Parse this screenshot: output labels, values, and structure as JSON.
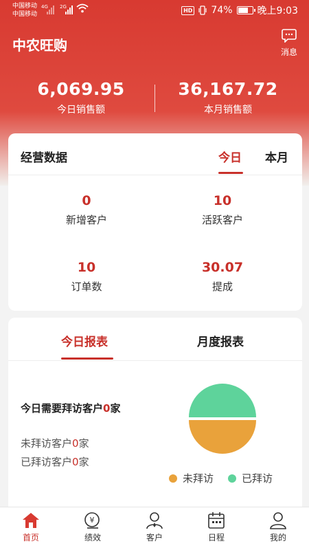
{
  "status_bar": {
    "carrier_1": "中国移动",
    "carrier_2": "中国移动",
    "net_1": "4G",
    "net_2": "2G",
    "hd": "HD",
    "battery": "74%",
    "battery_level": 0.74,
    "time": "晚上9:03"
  },
  "header": {
    "title": "中农旺购",
    "message_label": "消息",
    "message_icon": "chat-bubble-icon"
  },
  "totals": {
    "today": {
      "value": "6,069.95",
      "label": "今日销售额"
    },
    "month": {
      "value": "36,167.72",
      "label": "本月销售额"
    }
  },
  "business": {
    "title": "经营数据",
    "tabs": [
      {
        "label": "今日",
        "active": true
      },
      {
        "label": "本月",
        "active": false
      }
    ],
    "metrics": [
      {
        "value": "0",
        "label": "新增客户"
      },
      {
        "value": "10",
        "label": "活跃客户"
      },
      {
        "value": "10",
        "label": "订单数"
      },
      {
        "value": "30.07",
        "label": "提成"
      }
    ]
  },
  "report": {
    "tabs": [
      {
        "label": "今日报表",
        "active": true
      },
      {
        "label": "月度报表",
        "active": false
      }
    ],
    "visit_title_pre": "今日需要拜访客户",
    "visit_total": "0",
    "visit_title_post": "家",
    "unvisited_pre": "未拜访客户",
    "unvisited_count": "0",
    "unvisited_post": "家",
    "visited_pre": "已拜访客户",
    "visited_count": "0",
    "visited_post": "家",
    "legend": [
      {
        "label": "未拜访",
        "color": "#e9a23b"
      },
      {
        "label": "已拜访",
        "color": "#5ed39b"
      }
    ]
  },
  "colors": {
    "brand": "#d83a31",
    "accent_text": "#c8302a"
  },
  "nav": [
    {
      "label": "首页",
      "icon": "home-icon",
      "active": true
    },
    {
      "label": "绩效",
      "icon": "performance-coin-icon",
      "active": false
    },
    {
      "label": "客户",
      "icon": "customer-icon",
      "active": false
    },
    {
      "label": "日程",
      "icon": "calendar-icon",
      "active": false
    },
    {
      "label": "我的",
      "icon": "profile-icon",
      "active": false
    }
  ]
}
